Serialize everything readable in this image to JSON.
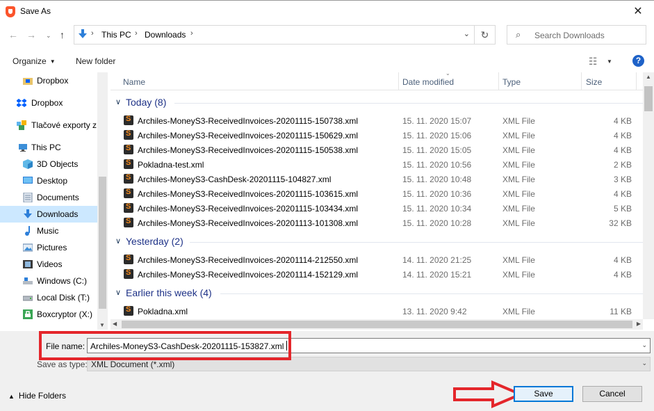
{
  "window": {
    "title": "Save As",
    "close_glyph": "✕"
  },
  "address": {
    "crumbs": [
      "This PC",
      "Downloads"
    ],
    "search_placeholder": "Search Downloads"
  },
  "toolbar": {
    "organize": "Organize",
    "new_folder": "New folder",
    "help": "?"
  },
  "nav": {
    "items": [
      {
        "label": "Dropbox",
        "icon": "dropbox-folder-icon"
      },
      {
        "label": "Dropbox",
        "icon": "dropbox-icon"
      },
      {
        "label": "Tlačové exporty z",
        "icon": "shared-folder-icon"
      },
      {
        "label": "This PC",
        "icon": "this-pc-icon"
      },
      {
        "label": "3D Objects",
        "icon": "3d-objects-icon"
      },
      {
        "label": "Desktop",
        "icon": "desktop-icon"
      },
      {
        "label": "Documents",
        "icon": "documents-icon"
      },
      {
        "label": "Downloads",
        "icon": "downloads-icon",
        "selected": true
      },
      {
        "label": "Music",
        "icon": "music-icon"
      },
      {
        "label": "Pictures",
        "icon": "pictures-icon"
      },
      {
        "label": "Videos",
        "icon": "videos-icon"
      },
      {
        "label": "Windows (C:)",
        "icon": "drive-icon"
      },
      {
        "label": "Local Disk (T:)",
        "icon": "drive-icon"
      },
      {
        "label": "Boxcryptor (X:)",
        "icon": "boxcryptor-drive-icon"
      }
    ]
  },
  "columns": {
    "name": "Name",
    "date": "Date modified",
    "type": "Type",
    "size": "Size"
  },
  "groups": [
    {
      "title": "Today (8)",
      "files": [
        {
          "name": "Archiles-MoneyS3-ReceivedInvoices-20201115-150738.xml",
          "date": "15. 11. 2020 15:07",
          "type": "XML File",
          "size": "4 KB"
        },
        {
          "name": "Archiles-MoneyS3-ReceivedInvoices-20201115-150629.xml",
          "date": "15. 11. 2020 15:06",
          "type": "XML File",
          "size": "4 KB"
        },
        {
          "name": "Archiles-MoneyS3-ReceivedInvoices-20201115-150538.xml",
          "date": "15. 11. 2020 15:05",
          "type": "XML File",
          "size": "4 KB"
        },
        {
          "name": "Pokladna-test.xml",
          "date": "15. 11. 2020 10:56",
          "type": "XML File",
          "size": "2 KB"
        },
        {
          "name": "Archiles-MoneyS3-CashDesk-20201115-104827.xml",
          "date": "15. 11. 2020 10:48",
          "type": "XML File",
          "size": "3 KB"
        },
        {
          "name": "Archiles-MoneyS3-ReceivedInvoices-20201115-103615.xml",
          "date": "15. 11. 2020 10:36",
          "type": "XML File",
          "size": "4 KB"
        },
        {
          "name": "Archiles-MoneyS3-ReceivedInvoices-20201115-103434.xml",
          "date": "15. 11. 2020 10:34",
          "type": "XML File",
          "size": "5 KB"
        },
        {
          "name": "Archiles-MoneyS3-ReceivedInvoices-20201113-101308.xml",
          "date": "15. 11. 2020 10:28",
          "type": "XML File",
          "size": "32 KB"
        }
      ]
    },
    {
      "title": "Yesterday (2)",
      "files": [
        {
          "name": "Archiles-MoneyS3-ReceivedInvoices-20201114-212550.xml",
          "date": "14. 11. 2020 21:25",
          "type": "XML File",
          "size": "4 KB"
        },
        {
          "name": "Archiles-MoneyS3-ReceivedInvoices-20201114-152129.xml",
          "date": "14. 11. 2020 15:21",
          "type": "XML File",
          "size": "4 KB"
        }
      ]
    },
    {
      "title": "Earlier this week (4)",
      "files": [
        {
          "name": "Pokladna.xml",
          "date": "13. 11. 2020 9:42",
          "type": "XML File",
          "size": "11 KB"
        }
      ]
    }
  ],
  "form": {
    "file_name_label": "File name:",
    "file_name_value": "Archiles-MoneyS3-CashDesk-20201115-153827.xml",
    "save_type_label": "Save as type:",
    "save_type_value": "XML Document (*.xml)",
    "hide_folders": "Hide Folders",
    "save": "Save",
    "cancel": "Cancel"
  },
  "colors": {
    "annotation_red": "#e4262b",
    "selection": "#cce8ff",
    "group_title": "#1e3287",
    "accent": "#0078d7"
  }
}
